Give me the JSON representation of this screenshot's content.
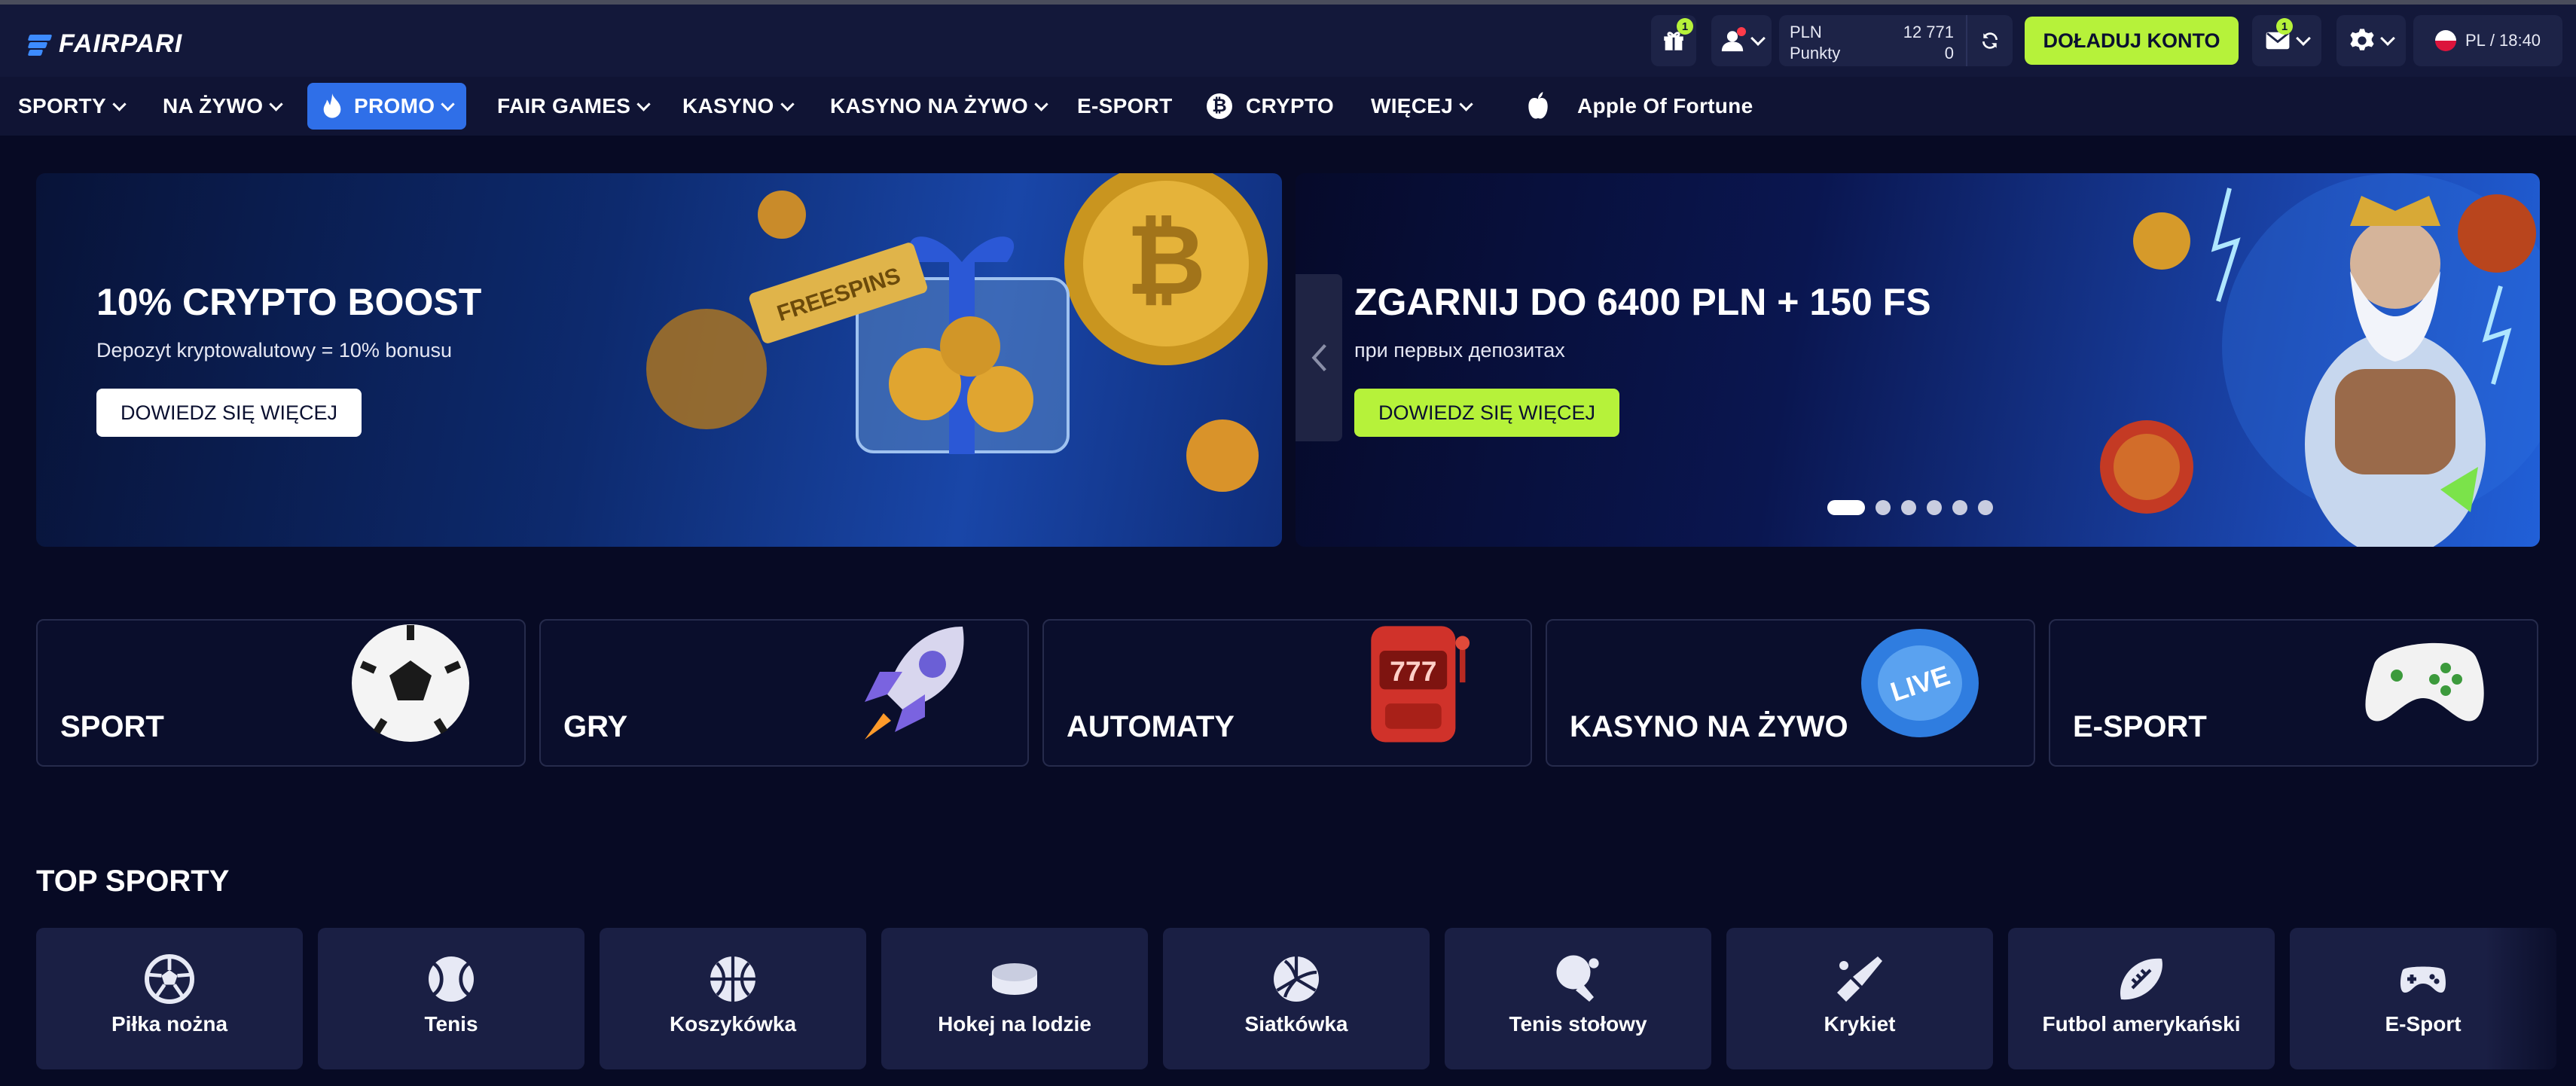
{
  "header": {
    "logo_text": "FAIRPARI",
    "gift_badge": "1",
    "balance": {
      "currency": "PLN",
      "amount": "12 771",
      "points_label": "Punkty",
      "points": "0"
    },
    "deposit_label": "DOŁADUJ KONTO",
    "mail_badge": "1",
    "locale": "PL",
    "time": "18:40",
    "locale_sep": "/"
  },
  "nav": {
    "sports": "SPORTY",
    "live": "NA ŻYWO",
    "promo": "PROMO",
    "fair_games": "FAIR GAMES",
    "casino": "KASYNO",
    "live_casino": "KASYNO NA ŻYWO",
    "esport": "E-SPORT",
    "crypto": "CRYPTO",
    "more": "WIĘCEJ",
    "apple": "Apple Of Fortune"
  },
  "banners": [
    {
      "title": "10% CRYPTO BOOST",
      "subtitle": "Depozyt kryptowalutowy = 10% bonusu",
      "button": "DOWIEDZ SIĘ WIĘCEJ",
      "tag": "FREESPINS"
    },
    {
      "title": "ZGARNIJ DO 6400 PLN + 150 FS",
      "subtitle": "при первых депозитах",
      "button": "DOWIEDZ SIĘ WIĘCEJ"
    }
  ],
  "carousel": {
    "total": 6,
    "active": 1
  },
  "categories": [
    "SPORT",
    "GRY",
    "AUTOMATY",
    "KASYNO NA ŻYWO",
    "E-SPORT"
  ],
  "category_art": {
    "live_chip": "LIVE",
    "slot_reels": "777"
  },
  "top_sports": {
    "title": "TOP SPORTY",
    "items": [
      "Piłka nożna",
      "Tenis",
      "Koszykówka",
      "Hokej na lodzie",
      "Siatkówka",
      "Tenis stołowy",
      "Krykiet",
      "Futbol amerykański",
      "E-Sport"
    ]
  },
  "colors": {
    "accent_green": "#b6f23a",
    "accent_blue": "#2f6fe8",
    "bg": "#070a24"
  }
}
